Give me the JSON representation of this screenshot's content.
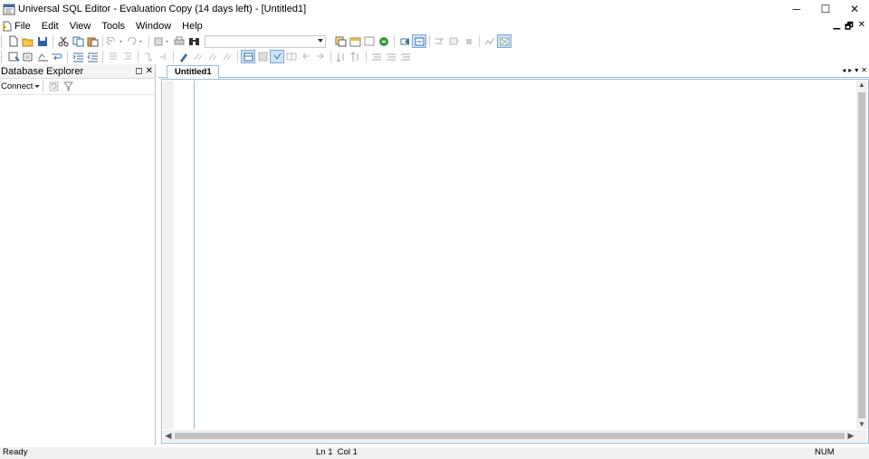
{
  "window": {
    "title": "Universal SQL Editor - Evaluation Copy (14 days left) - [Untitled1]",
    "controls": {
      "minimize": "─",
      "maximize": "☐",
      "close": "✕"
    }
  },
  "menu": {
    "items": [
      "File",
      "Edit",
      "View",
      "Tools",
      "Window",
      "Help"
    ],
    "mdi_controls": {
      "minimize": "▁",
      "restore": "🗗",
      "close": "✕"
    }
  },
  "toolbar": {
    "search_combo_value": ""
  },
  "explorer": {
    "title": "Database Explorer",
    "connect_label": "Connect",
    "pin_glyph": "◻",
    "close_glyph": "✕"
  },
  "tabs": {
    "items": [
      {
        "label": "Untitled1",
        "active": true
      }
    ],
    "nav_glyphs": [
      "◂",
      "▸",
      "▾",
      "✕"
    ]
  },
  "editor": {
    "content": "",
    "scroll_up": "▲",
    "scroll_down": "▼",
    "scroll_left": "◀",
    "scroll_right": "▶"
  },
  "status": {
    "state": "Ready",
    "line": "Ln 1",
    "col": "Col 1",
    "num": "NUM"
  },
  "colors": {
    "accent": "#9bbcd6",
    "toolbar_active": "#cce4f7",
    "status_bg": "#f0f0f0"
  }
}
